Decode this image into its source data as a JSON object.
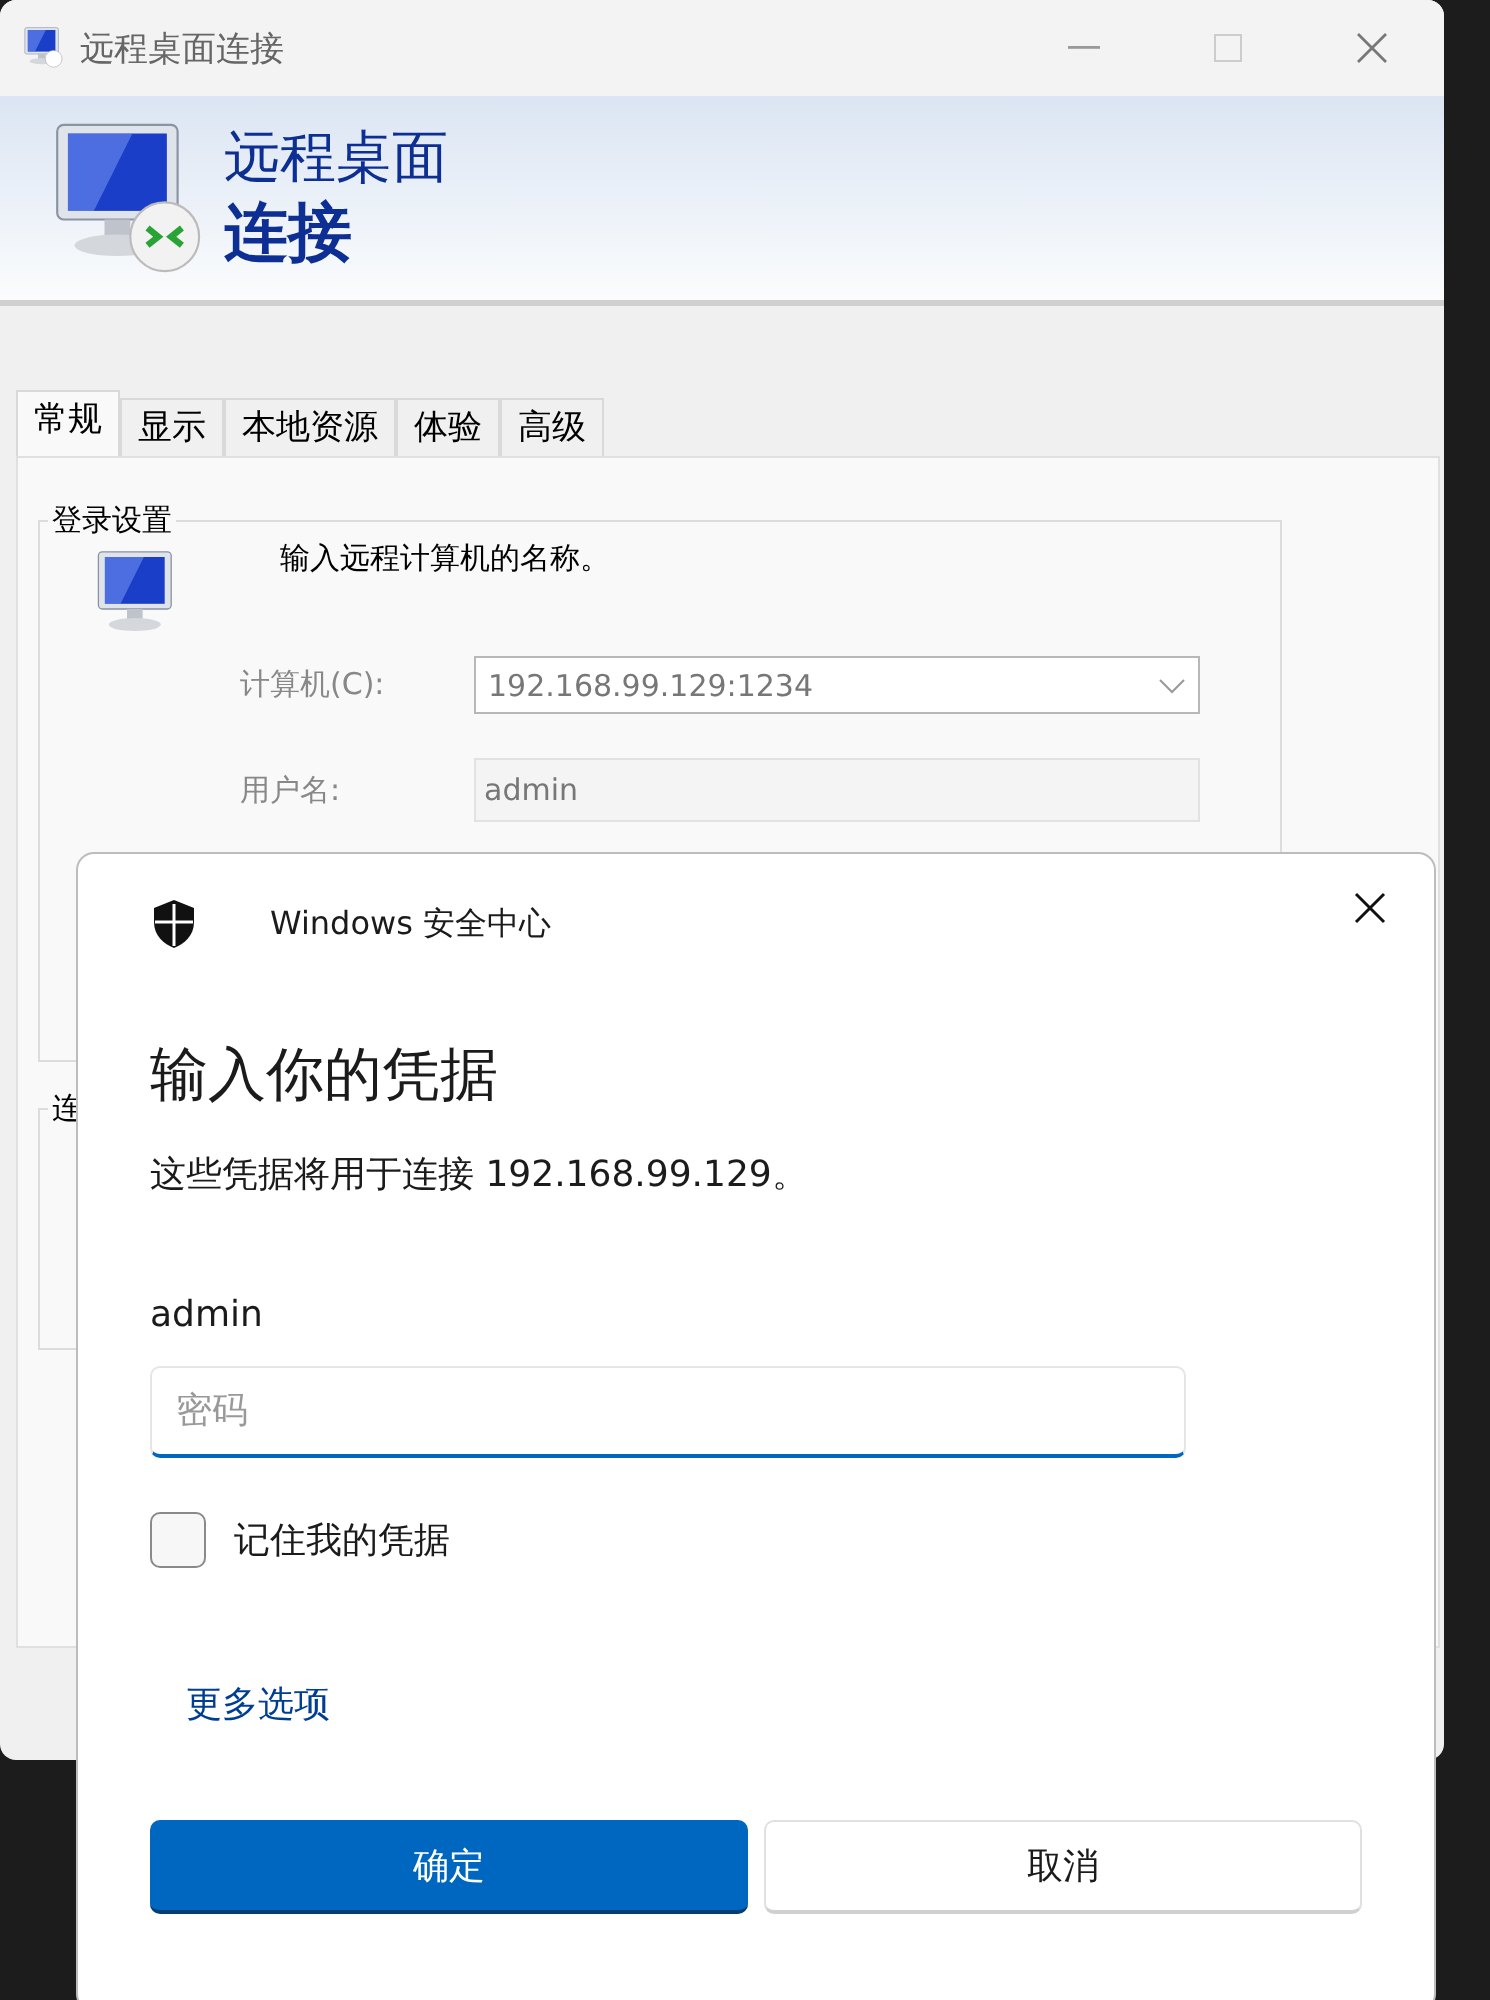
{
  "window": {
    "title": "远程桌面连接"
  },
  "banner": {
    "line_1": "远程桌面",
    "line_2": "连接"
  },
  "tabs": [
    {
      "label": "常规",
      "selected": true
    },
    {
      "label": "显示",
      "selected": false
    },
    {
      "label": "本地资源",
      "selected": false
    },
    {
      "label": "体验",
      "selected": false
    },
    {
      "label": "高级",
      "selected": false
    }
  ],
  "login_group": {
    "title": "登录设置",
    "prompt": "输入远程计算机的名称。",
    "computer_label": "计算机(C):",
    "computer_value": "192.168.99.129:1234",
    "username_label": "用户名:",
    "username_value": "admin"
  },
  "connection_group": {
    "title": "连"
  },
  "dialog": {
    "source": "Windows 安全中心",
    "heading": "输入你的凭据",
    "message": "这些凭据将用于连接 192.168.99.129。",
    "username": "admin",
    "password_placeholder": "密码",
    "remember": {
      "label": "记住我的凭据",
      "checked": false
    },
    "more_options": "更多选项",
    "buttons": [
      {
        "label": "确定",
        "kind": "primary"
      },
      {
        "label": "取消",
        "kind": "secondary"
      }
    ]
  }
}
